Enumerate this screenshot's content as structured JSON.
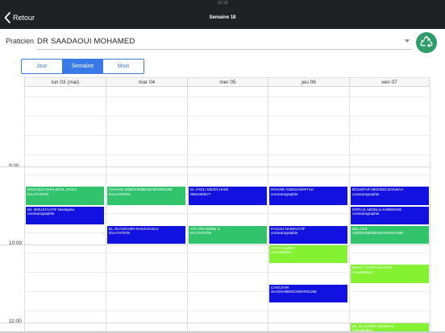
{
  "status_bar": {
    "time": "16:18"
  },
  "nav": {
    "back_label": "Retour",
    "title": "Semaine 18"
  },
  "praticien": {
    "label": "Praticien",
    "value": "DR SAADAOUI MOHAMED"
  },
  "view_tabs": [
    {
      "label": "Jour",
      "active": false
    },
    {
      "label": "Semaine",
      "active": true
    },
    {
      "label": "Mois",
      "active": false
    }
  ],
  "days": [
    {
      "label": "lun 03 (mai)"
    },
    {
      "label": "mar 04"
    },
    {
      "label": "mer 05"
    },
    {
      "label": "jeu 06"
    },
    {
      "label": "ven 07"
    }
  ],
  "time_labels": [
    "9:00",
    "10:00",
    "11:00"
  ],
  "events": [
    {
      "day": 0,
      "line1": "MACHICH KHALID/EL JAOUI",
      "line2": "DILATATION",
      "color": "green",
      "start": "9:15",
      "end": "9:30"
    },
    {
      "day": 0,
      "line1": "Mr.  MOUSTAATIF Mustapha",
      "line2": "coronarographie",
      "color": "blue",
      "start": "9:30",
      "end": "9:45"
    },
    {
      "day": 1,
      "line1": "CHAFAK KEBOUR/BENCHEKROUNE",
      "line2": "DILATATION",
      "color": "green",
      "start": "9:15",
      "end": "9:30"
    },
    {
      "day": 1,
      "line1": "EL OUADGHIRI RADIA/HJIAJ",
      "line2": "DILATATION",
      "color": "blue",
      "start": "9:45",
      "end": "10:00"
    },
    {
      "day": 2,
      "line1": "EL FADLI MED/CHAMI",
      "line2": "0664490577",
      "color": "blue",
      "start": "9:15",
      "end": "9:30"
    },
    {
      "day": 2,
      "line1": "ATC DR AMINE S",
      "line2": "DILATATION",
      "color": "green",
      "start": "9:45",
      "end": "10:00"
    },
    {
      "day": 3,
      "line1": "RIHANE ANISSA/MIFTAH",
      "line2": "coronarographie",
      "color": "blue",
      "start": "9:15",
      "end": "9:30"
    },
    {
      "day": 3,
      "line1": "FAGOU NAIMA/ATIF",
      "line2": "coronarographie",
      "color": "blue",
      "start": "9:45",
      "end": "10:00"
    },
    {
      "day": 3,
      "line1": "RAFII AHMED",
      "line2": "Consultation",
      "color": "lime",
      "start": "10:00",
      "end": "10:15"
    },
    {
      "day": 3,
      "line1": "CHOUTAR",
      "line2": "SAADIA/BENCHEKROUNE",
      "color": "blue",
      "start": "10:30",
      "end": "10:45"
    },
    {
      "day": 4,
      "line1": "BOUSFAR MED/BOUZOUBAA",
      "line2": "coronarographie",
      "color": "blue",
      "start": "9:15",
      "end": "9:30"
    },
    {
      "day": 4,
      "line1": "ERRAJI ABDELILAH/BENNIS",
      "line2": "coronarographie",
      "color": "blue",
      "start": "9:30",
      "end": "9:45"
    },
    {
      "day": 4,
      "line1": "BELAZIZ",
      "line2": "AZEDDINE/BENCHEKROUNE",
      "color": "green",
      "start": "9:45",
      "end": "10:00"
    },
    {
      "day": 4,
      "line1": "BAHLI FATMA ZOHARE",
      "line2": "Consultation",
      "color": "lime",
      "start": "10:15",
      "end": "10:30"
    },
    {
      "day": 4,
      "line1": "Mr.  EL KADIRI Mohamed",
      "line2": "Consultation",
      "color": "lime",
      "start": "11:00",
      "end": "11:15"
    }
  ],
  "colors": {
    "green": "#32c46d",
    "blue": "#1212e0",
    "lime": "#84f230",
    "accent": "#3a7ae8",
    "nav_bg": "#1f2224"
  },
  "icons": {
    "back": "chevron-left-icon",
    "refresh": "recycle-icon",
    "dropdown": "caret-down-icon"
  }
}
